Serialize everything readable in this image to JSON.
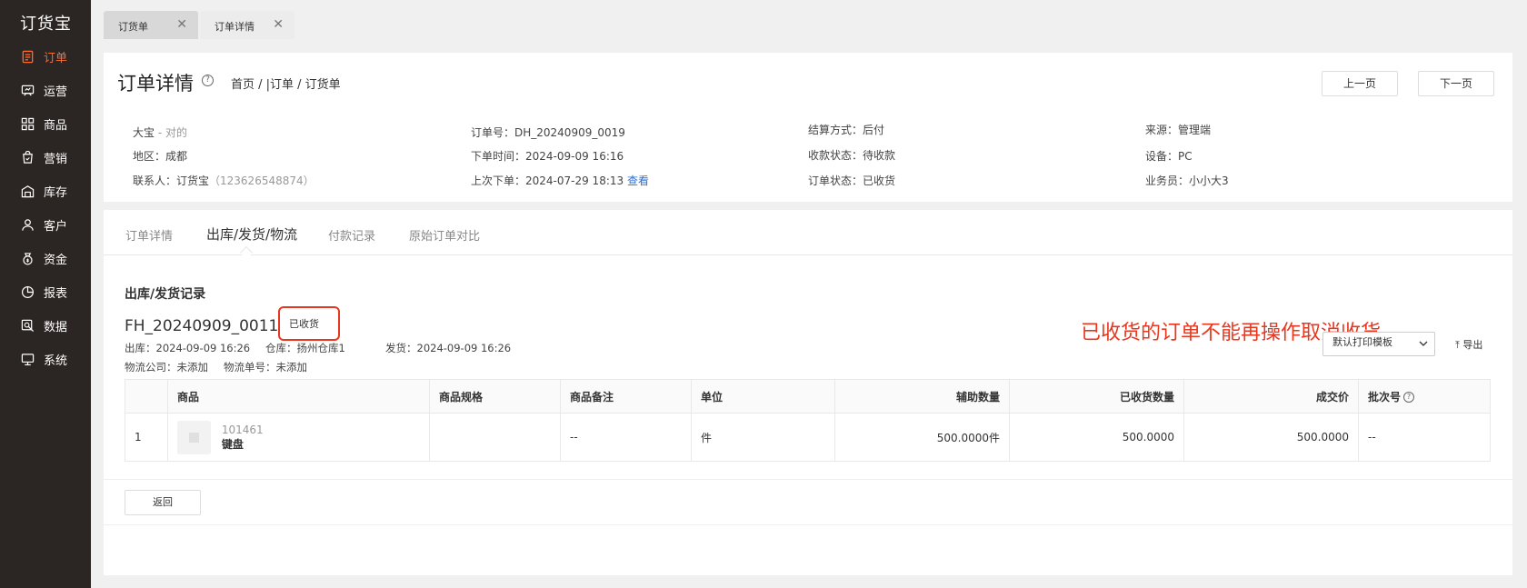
{
  "app": {
    "logo": "订货宝"
  },
  "sidebar": {
    "items": [
      {
        "label": "订单",
        "icon": "order-icon"
      },
      {
        "label": "运营",
        "icon": "operation-icon"
      },
      {
        "label": "商品",
        "icon": "product-icon"
      },
      {
        "label": "营销",
        "icon": "marketing-icon"
      },
      {
        "label": "库存",
        "icon": "warehouse-icon"
      },
      {
        "label": "客户",
        "icon": "customer-icon"
      },
      {
        "label": "资金",
        "icon": "funds-icon"
      },
      {
        "label": "报表",
        "icon": "report-icon"
      },
      {
        "label": "数据",
        "icon": "data-icon"
      },
      {
        "label": "系统",
        "icon": "system-icon"
      }
    ],
    "active_color": "#ff6a2f"
  },
  "tabs": [
    {
      "label": "订货单",
      "close": "✕"
    },
    {
      "label": "订单详情",
      "close": "✕"
    }
  ],
  "header": {
    "title": "订单详情",
    "help": "?",
    "breadcrumb": "首页 / |订单 / 订货单",
    "prev_label": "上一页",
    "next_label": "下一页"
  },
  "info": {
    "customer_name": "大宝",
    "customer_alias": " - 对的",
    "region": "地区：成都",
    "contact": "联系人：订货宝",
    "contact_phone": "（123626548874）",
    "order_no": "订单号：DH_20240909_0019",
    "order_time": "下单时间：2024-09-09 16:16",
    "last_order": "上次下单：2024-07-29 18:13",
    "view_link": "查看",
    "settlement": "结算方式：后付",
    "payment_status": "收款状态：待收款",
    "order_status": "订单状态：已收货",
    "source": "来源：管理端",
    "device": "设备：PC",
    "salesperson": "业务员：小小大3"
  },
  "subtabs": [
    {
      "label": "订单详情"
    },
    {
      "label": "出库/发货/物流"
    },
    {
      "label": "付款记录"
    },
    {
      "label": "原始订单对比"
    }
  ],
  "shipment": {
    "section_title": "出库/发货记录",
    "fh_no": "FH_20240909_0011",
    "status": "已收货",
    "out_time": "出库：2024-09-09 16:26",
    "warehouse": "仓库：扬州仓库1",
    "ship_time": "发货：2024-09-09 16:26",
    "logistics_company": "物流公司：未添加",
    "tracking_no": "物流单号：未添加",
    "print_template": "默认打印模板",
    "export_label": "导出",
    "annotation": "已收货的订单不能再操作取消收货"
  },
  "table": {
    "headers": [
      "",
      "商品",
      "商品规格",
      "商品备注",
      "单位",
      "辅助数量",
      "已收货数量",
      "成交价",
      "批次号"
    ],
    "rows": [
      {
        "index": "1",
        "code": "101461",
        "name": "键盘",
        "spec": "",
        "remark": "--",
        "unit": "件",
        "aux_qty": "500.0000件",
        "received_qty": "500.0000",
        "price": "500.0000",
        "batch": "--"
      }
    ]
  },
  "footer": {
    "back_label": "返回"
  }
}
